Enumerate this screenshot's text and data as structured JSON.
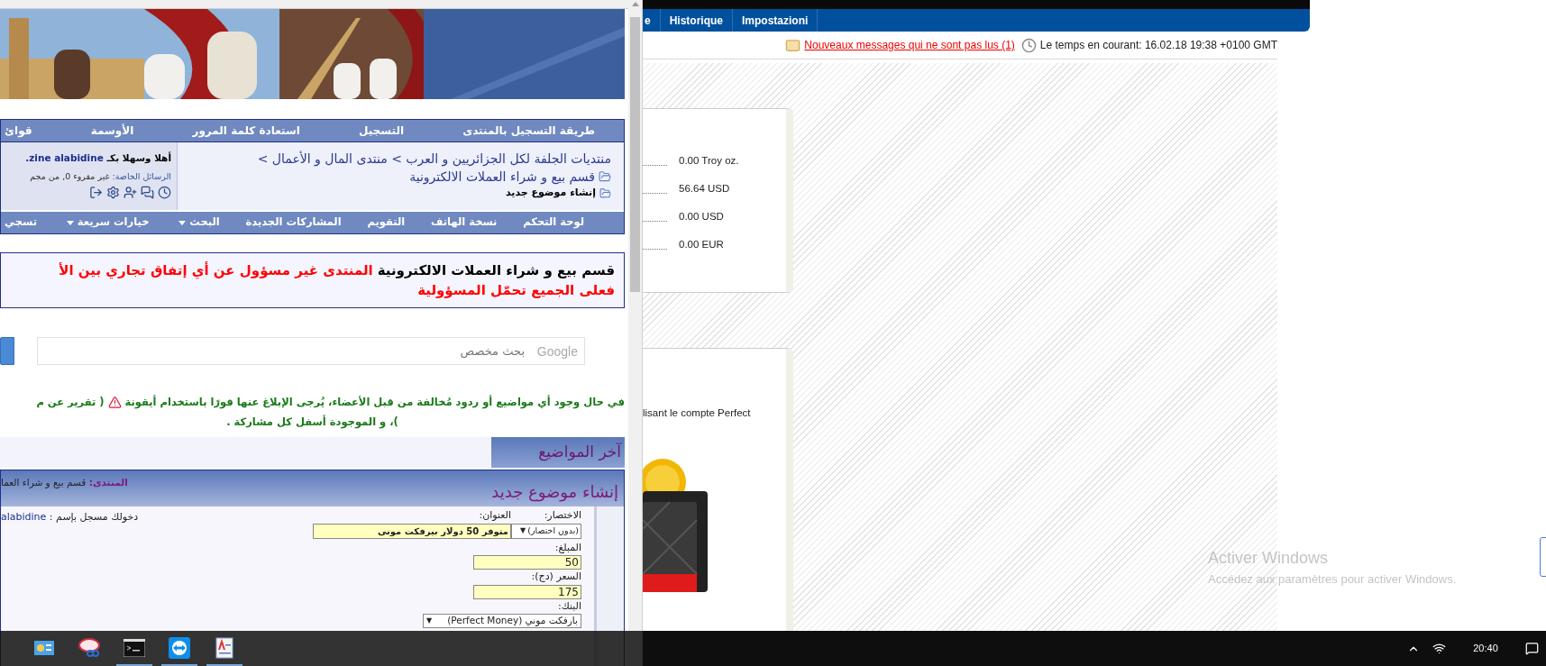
{
  "forum": {
    "nav_top": [
      "طريقة التسجيل بالمنتدى",
      "التسجيل",
      "استعادة كلمة المرور",
      "الأوسمة",
      "قوائ"
    ],
    "breadcrumb": {
      "path": "منتديات الجلفة لكل الجزائريين و العرب > منتدى المال و الأعمال >",
      "section": "قسم بيع و شراء العملات الالكترونية",
      "current": "إنشاء موضوع جديد"
    },
    "welcome": {
      "greeting": "أهلا وسهلا بكـ",
      "username": "zine alabidine.",
      "messages_label": "الرسائل الخاصة:",
      "messages_value": "غير مقروء 0, من مجم"
    },
    "nav_bottom": [
      {
        "label": "لوحة التحكم",
        "dropdown": false
      },
      {
        "label": "نسخة الهاتف",
        "dropdown": false
      },
      {
        "label": "التقويم",
        "dropdown": false
      },
      {
        "label": "المشاركات الجديدة",
        "dropdown": false
      },
      {
        "label": "البحث",
        "dropdown": true
      },
      {
        "label": "خيارات سريعة",
        "dropdown": true
      },
      {
        "label": "تسجي",
        "dropdown": false
      }
    ],
    "notice": {
      "section": "قسم بيع و شراء العملات الالكترونية",
      "warning": "المنتدى غير مسؤول عن أي إتفاق تجاري بين الأ",
      "warning_line2": "فعلى الجميع تحمّل المسؤولية"
    },
    "search": {
      "brand": "Google",
      "placeholder": "بحث مخصص"
    },
    "report_notice": {
      "line1": "في حال وجود أي مواضيع أو ردود مُخالفة من قبل الأعضاء، يُرجى الإبلاغ عنها فورًا باستخدام أيقونة",
      "line1_end": "( تقرير عن م",
      "line2": ")، و الموجودة أسفل كل مشاركة ."
    },
    "latest_topics": "آخر المواضيع",
    "new_topic": {
      "title": "إنشاء موضوع جديد",
      "forum_label": "المنتدى:",
      "forum_name": "قسم بيع و شراء العما",
      "logged_in": "دخولك مسجل بإسم :",
      "username": "alabidine",
      "prefix": {
        "label": "الاختصار:",
        "value": "(بدون اختصار)",
        "arrow": "▼"
      },
      "subject": {
        "label": "العنوان:",
        "value": "متوفر 50 دولار بيرفكت موني"
      },
      "amount": {
        "label": "المبلغ:",
        "value": "50"
      },
      "price": {
        "label": "السعر (دج):",
        "value": "175"
      },
      "bank": {
        "label": "البنك:",
        "value": "بارفكت موني (Perfect Money)",
        "arrow": "▼"
      }
    }
  },
  "wallet": {
    "nav_cut_item": "e",
    "nav_history": "Historique",
    "nav_settings": "Impostazioni",
    "messages_link": "Nouveaux messages qui ne sont pas lus (1)",
    "time": "Le temps en courant: 16.02.18 19:38 +0100 GMT",
    "balances": [
      "0.00 Troy oz.",
      "56.64 USD",
      "0.00 USD",
      "0.00 EUR"
    ],
    "promo_text": "lisant le compte Perfect"
  },
  "activation": {
    "title": "Activer Windows",
    "subtitle": "Accédez aux paramètres pour activer Windows."
  },
  "taskbar": {
    "apps": [
      {
        "kind": "control-panel",
        "running": false
      },
      {
        "kind": "snipping",
        "running": false
      },
      {
        "kind": "terminal",
        "running": true
      },
      {
        "kind": "remote",
        "running": true
      },
      {
        "kind": "document",
        "running": true
      }
    ],
    "clock": "20:40"
  }
}
